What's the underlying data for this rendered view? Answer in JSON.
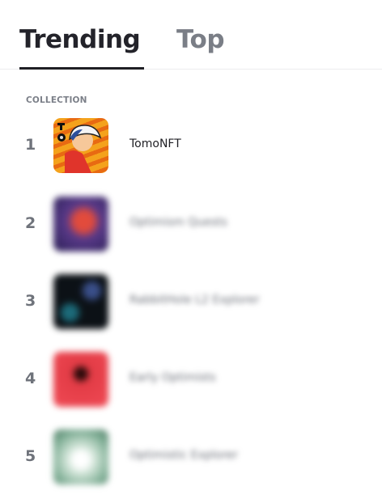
{
  "tabs": [
    {
      "label": "Trending",
      "active": true
    },
    {
      "label": "Top",
      "active": false
    }
  ],
  "table": {
    "column_header": "COLLECTION",
    "rows": [
      {
        "rank": "1",
        "name": "TomoNFT",
        "thumb_icon": "tomonft-avatar",
        "blurred": false
      },
      {
        "rank": "2",
        "name": "Optimism Quests",
        "thumb_icon": "collection-thumbnail",
        "blurred": true
      },
      {
        "rank": "3",
        "name": "RabbitHole L2 Explorer",
        "thumb_icon": "collection-thumbnail",
        "blurred": true
      },
      {
        "rank": "4",
        "name": "Early Optimists",
        "thumb_icon": "collection-thumbnail",
        "blurred": true
      },
      {
        "rank": "5",
        "name": "Optimistic Explorer",
        "thumb_icon": "collection-thumbnail",
        "blurred": true
      }
    ]
  }
}
